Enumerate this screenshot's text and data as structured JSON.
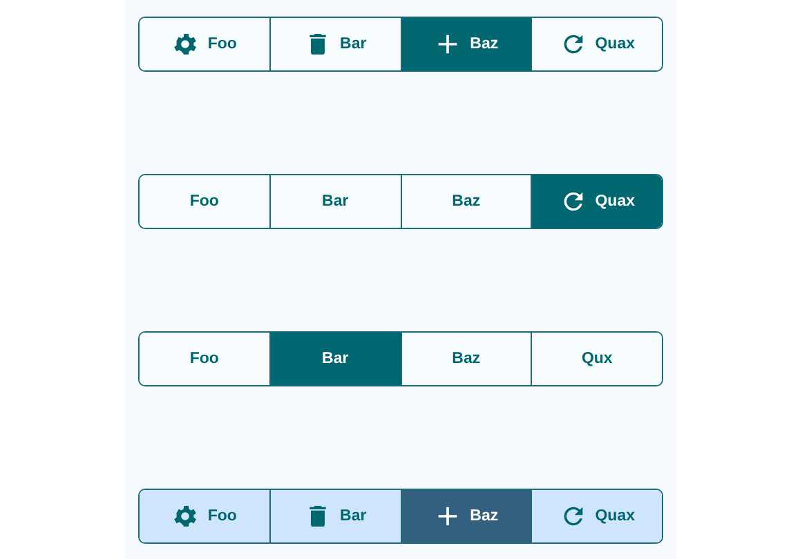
{
  "button_groups": [
    {
      "kind": "outline",
      "buttons": [
        {
          "label": "Foo",
          "kind": "gear",
          "selected": false
        },
        {
          "label": "Bar",
          "kind": "trash",
          "selected": false
        },
        {
          "label": "Baz",
          "kind": "plus",
          "selected": true
        },
        {
          "label": "Quax",
          "kind": "refresh",
          "selected": false
        }
      ]
    },
    {
      "kind": "outline",
      "buttons": [
        {
          "label": "Foo",
          "kind": "text",
          "selected": false
        },
        {
          "label": "Bar",
          "kind": "text",
          "selected": false
        },
        {
          "label": "Baz",
          "kind": "text",
          "selected": false
        },
        {
          "label": "Quax",
          "kind": "refresh",
          "selected": true
        }
      ]
    },
    {
      "kind": "outline",
      "buttons": [
        {
          "label": "Foo",
          "kind": "text",
          "selected": false
        },
        {
          "label": "Bar",
          "kind": "text",
          "selected": true
        },
        {
          "label": "Baz",
          "kind": "text",
          "selected": false
        },
        {
          "label": "Qux",
          "kind": "text",
          "selected": false
        }
      ]
    },
    {
      "kind": "tinted",
      "buttons": [
        {
          "label": "Foo",
          "kind": "gear",
          "selected": false
        },
        {
          "label": "Bar",
          "kind": "trash",
          "selected": false
        },
        {
          "label": "Baz",
          "kind": "plus",
          "selected": true
        },
        {
          "label": "Quax",
          "kind": "refresh",
          "selected": false
        }
      ]
    }
  ]
}
